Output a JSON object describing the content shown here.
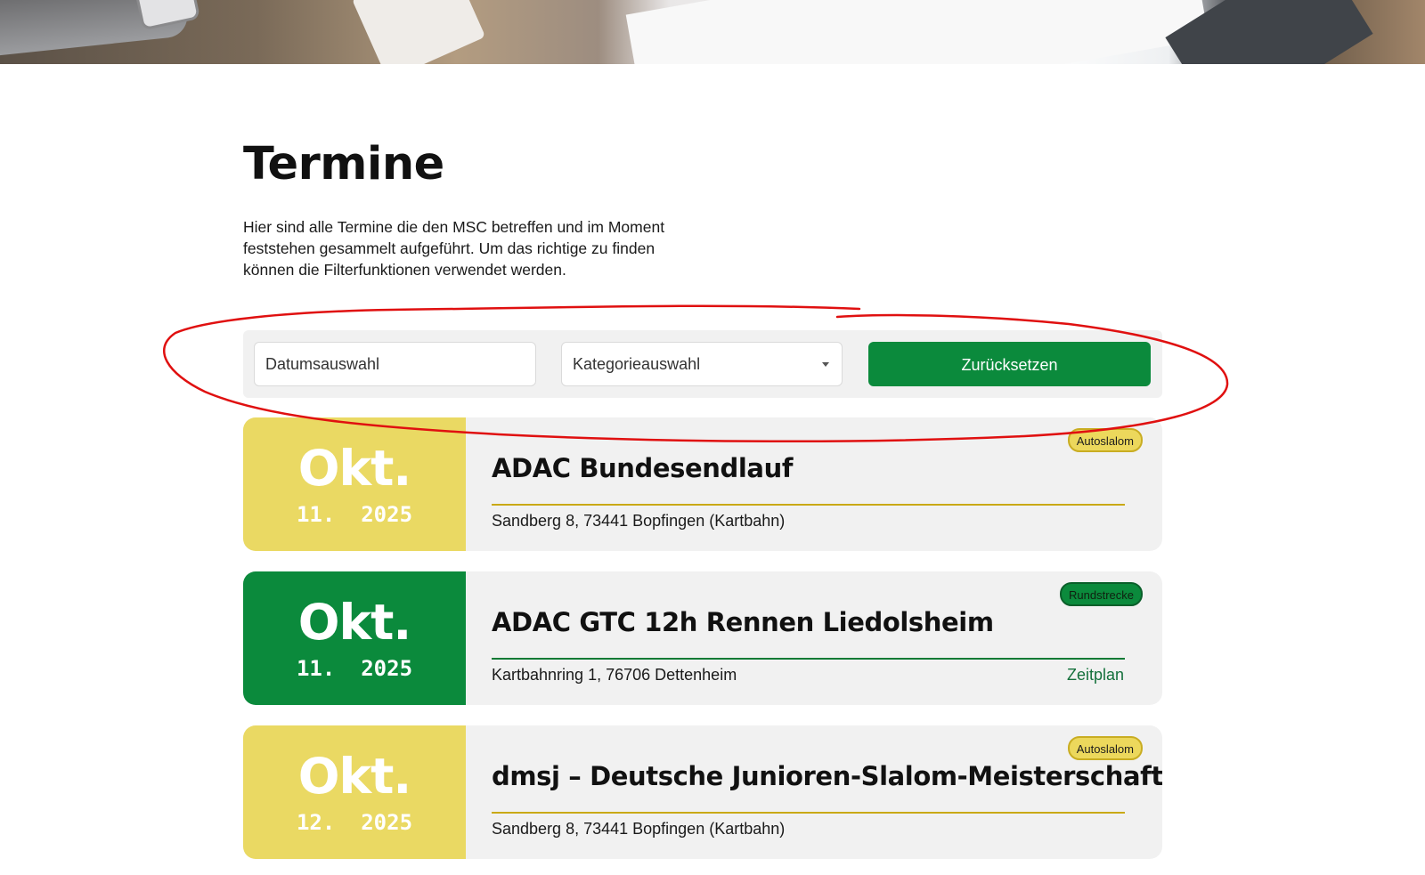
{
  "page": {
    "title": "Termine",
    "intro": "Hier sind alle Termine die den MSC betreffen und im Moment feststehen gesammelt aufgeführt. Um das richtige zu finden können die Filterfunktionen verwendet werden."
  },
  "filters": {
    "date_placeholder": "Datumsauswahl",
    "category_placeholder": "Kategorieauswahl",
    "reset_label": "Zurücksetzen"
  },
  "colors": {
    "accent_green": "#0b8a3c",
    "accent_yellow": "#ead963",
    "annotation_red": "#e01010"
  },
  "events": [
    {
      "month": "Okt.",
      "day_year": "11.  2025",
      "title": "ADAC Bundesendlauf",
      "address": "Sandberg 8, 73441 Bopfingen (Kartbahn)",
      "category": "Autoslalom",
      "link": ""
    },
    {
      "month": "Okt.",
      "day_year": "11.  2025",
      "title": "ADAC GTC 12h Rennen Liedolsheim",
      "address": "Kartbahnring 1, 76706 Dettenheim",
      "category": "Rundstrecke",
      "link": "Zeitplan"
    },
    {
      "month": "Okt.",
      "day_year": "12.  2025",
      "title": "dmsj – Deutsche Junioren-Slalom-Meisterschaft",
      "address": "Sandberg 8, 73441 Bopfingen (Kartbahn)",
      "category": "Autoslalom",
      "link": ""
    }
  ]
}
